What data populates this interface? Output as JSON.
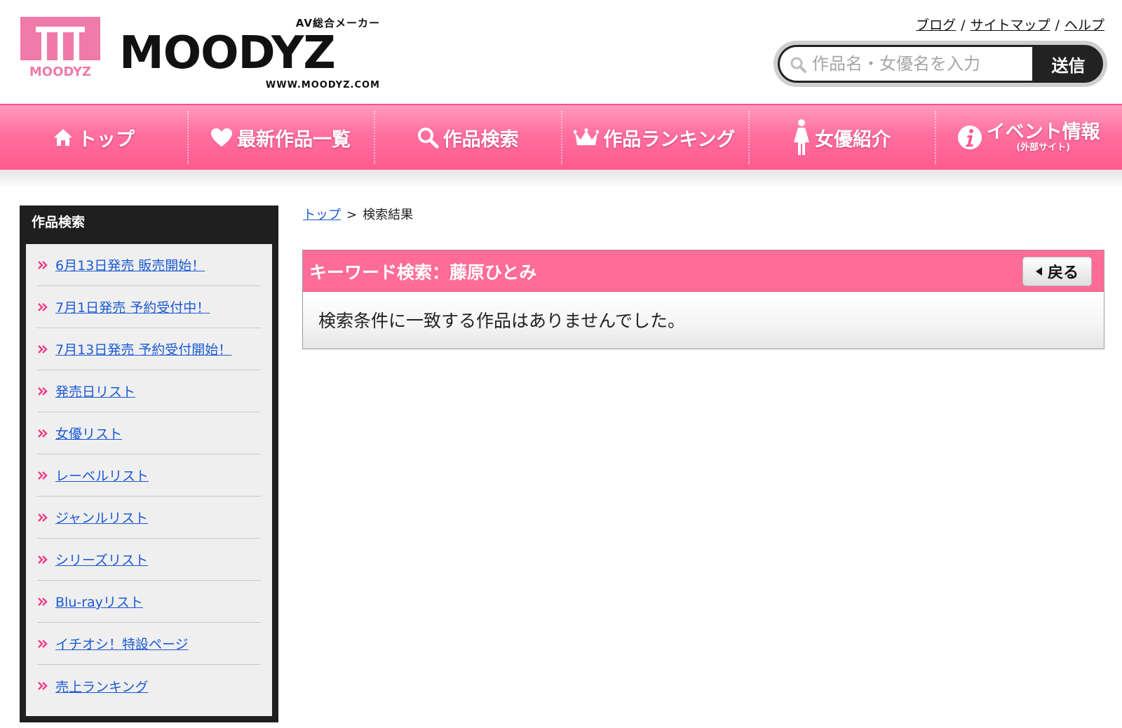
{
  "header": {
    "logo_mark_text": "MOODYZ",
    "logo_tagline": "AV総合メーカー",
    "logo_wordmark": "MOODYZ",
    "logo_url": "WWW.MOODYZ.COM",
    "links": [
      {
        "label": "ブログ"
      },
      {
        "label": "サイトマップ"
      },
      {
        "label": "ヘルプ"
      }
    ],
    "link_separator": "/",
    "search": {
      "placeholder": "作品名・女優名を入力",
      "value": "",
      "button_label": "送信"
    }
  },
  "nav": {
    "items": [
      {
        "label": "トップ",
        "icon": "home-icon"
      },
      {
        "label": "最新作品一覧",
        "icon": "heart-icon"
      },
      {
        "label": "作品検索",
        "icon": "search-icon"
      },
      {
        "label": "作品ランキング",
        "icon": "crown-icon"
      },
      {
        "label": "女優紹介",
        "icon": "woman-icon"
      },
      {
        "label": "イベント情報",
        "sub": "(外部サイト)",
        "icon": "info-icon"
      }
    ]
  },
  "sidebar": {
    "title": "作品検索",
    "items": [
      {
        "label": "6月13日発売 販売開始！"
      },
      {
        "label": "7月1日発売 予約受付中！"
      },
      {
        "label": "7月13日発売 予約受付開始！"
      },
      {
        "label": "発売日リスト"
      },
      {
        "label": "女優リスト"
      },
      {
        "label": "レーベルリスト"
      },
      {
        "label": "ジャンルリスト"
      },
      {
        "label": "シリーズリスト"
      },
      {
        "label": "Blu-rayリスト"
      },
      {
        "label": "イチオシ！特設ページ"
      },
      {
        "label": "売上ランキング"
      }
    ]
  },
  "breadcrumb": {
    "home": "トップ",
    "separator": ">",
    "current": "検索結果"
  },
  "result": {
    "heading": "キーワード検索：藤原ひとみ",
    "back_label": "戻る",
    "message": "検索条件に一致する作品はありませんでした。"
  },
  "colors": {
    "brand_pink": "#ff6c97",
    "link_blue": "#1a5ad4",
    "sidebar_dark": "#1f1f1f"
  }
}
